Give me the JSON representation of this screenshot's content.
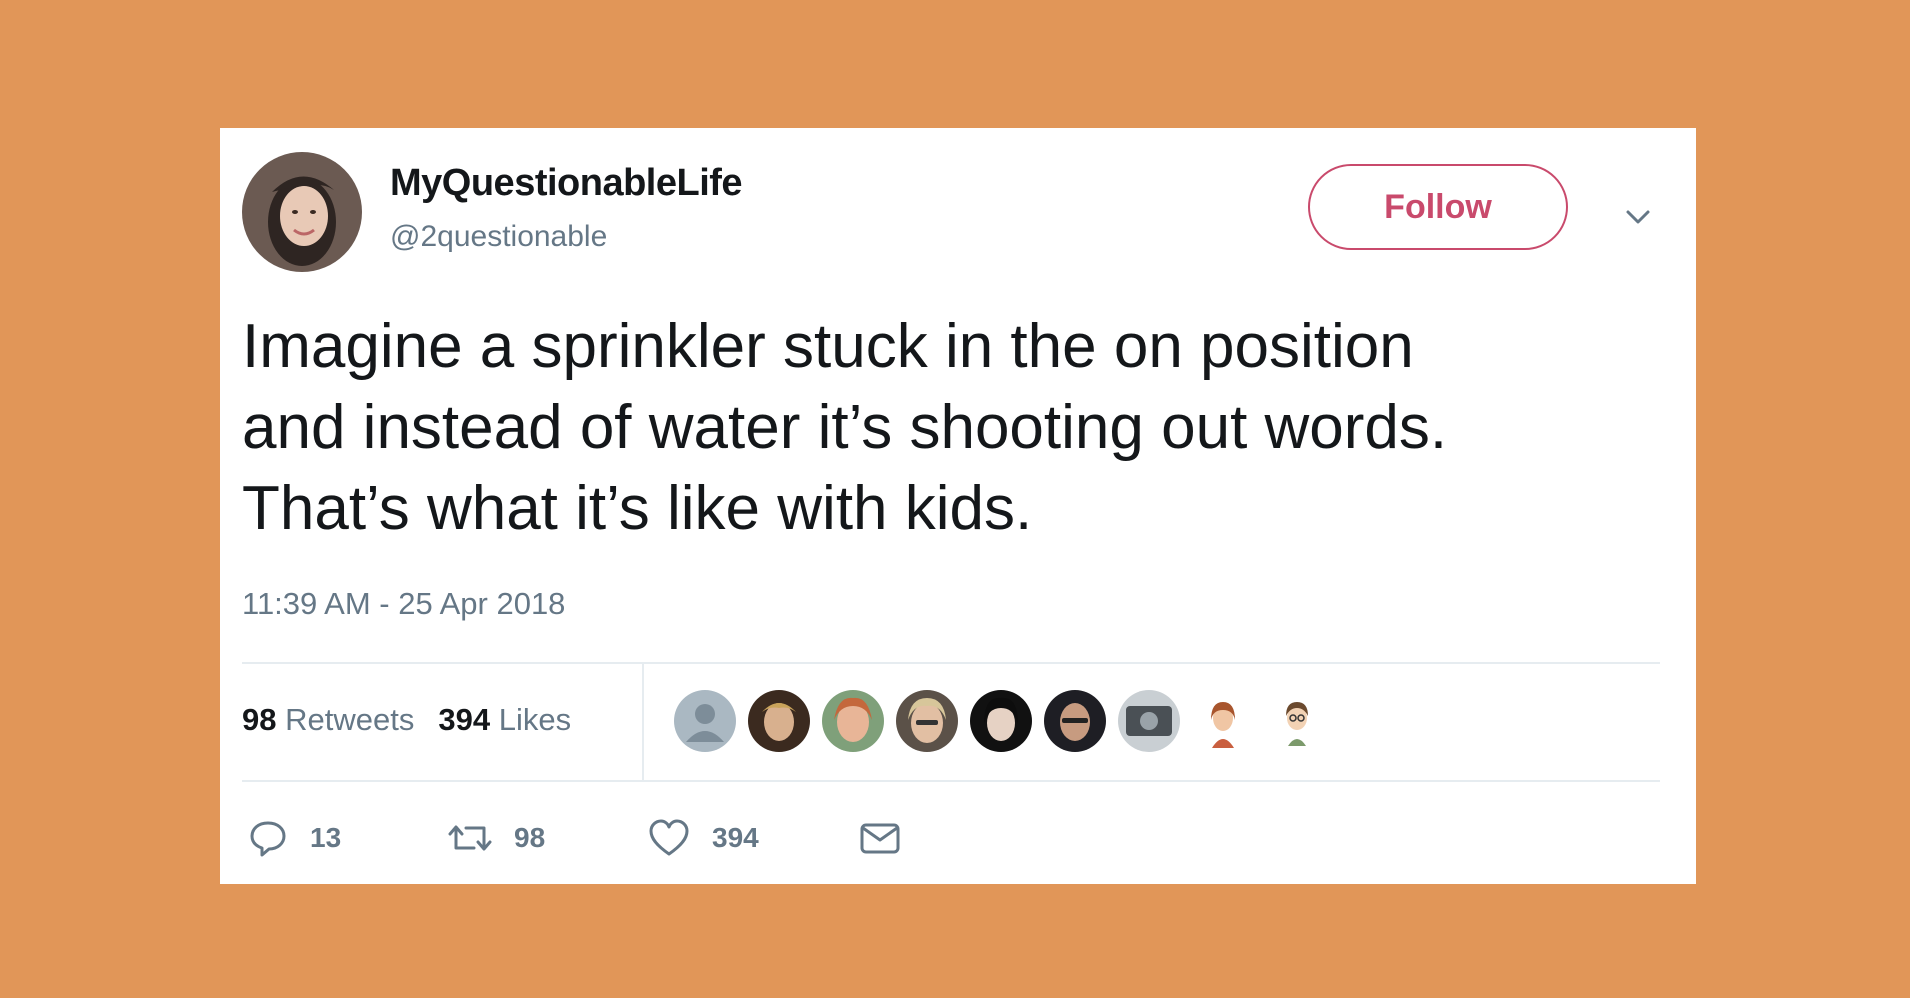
{
  "tweet": {
    "display_name": "MyQuestionableLife",
    "handle": "@2questionable",
    "follow_label": "Follow",
    "text_lines": [
      "Imagine a sprinkler stuck in the on position",
      "and instead of water it’s shooting out words.",
      "That’s what it’s like with kids."
    ],
    "timestamp": "11:39 AM - 25 Apr 2018"
  },
  "stats": {
    "retweets_count": "98",
    "retweets_label": "Retweets",
    "likes_count": "394",
    "likes_label": "Likes"
  },
  "likers": [
    {
      "name": "default-avatar",
      "bg": "#9aa7b0"
    },
    {
      "name": "liker-avatar-2",
      "bg": "#7a5a3f"
    },
    {
      "name": "liker-avatar-3",
      "bg": "#d9a27c"
    },
    {
      "name": "liker-avatar-4",
      "bg": "#8d8071"
    },
    {
      "name": "liker-avatar-5",
      "bg": "#2b2624"
    },
    {
      "name": "liker-avatar-6",
      "bg": "#3a3a40"
    },
    {
      "name": "liker-avatar-7",
      "bg": "#6a6f74"
    },
    {
      "name": "liker-avatar-8",
      "bg": "#ffffff"
    },
    {
      "name": "liker-avatar-9",
      "bg": "#ffffff"
    }
  ],
  "actions": {
    "replies": "13",
    "retweets": "98",
    "likes": "394"
  },
  "colors": {
    "background": "#E19658",
    "follow_accent": "#c94a6c",
    "muted": "#657786",
    "text": "#14171a"
  },
  "icons": [
    "reply-icon",
    "retweet-icon",
    "like-icon",
    "dm-icon",
    "chevron-down-icon"
  ]
}
